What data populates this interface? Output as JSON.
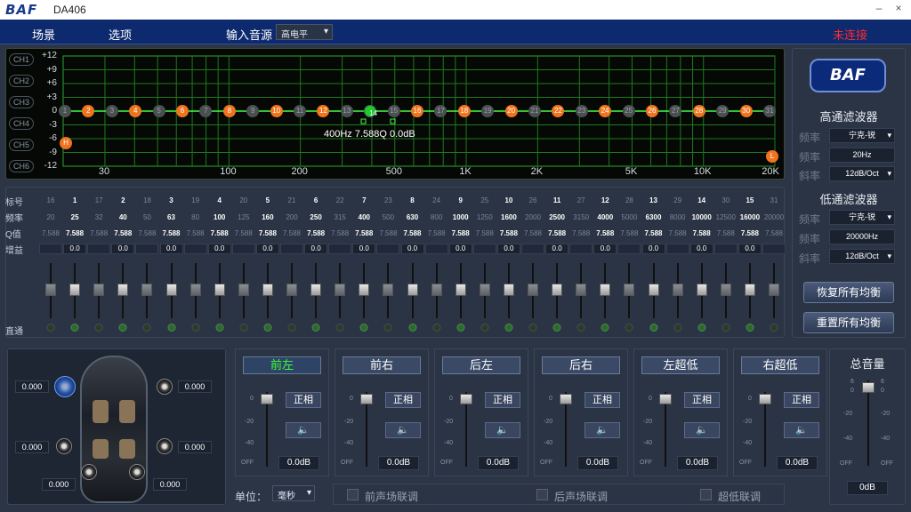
{
  "window": {
    "logo": "BAF",
    "title": "DA406",
    "minimize": "–",
    "close": "×"
  },
  "menu": {
    "scene": "场景",
    "options": "选项",
    "input_source_label": "输入音源",
    "input_source_value": "高电平",
    "connection_status": "未连接"
  },
  "graph": {
    "channels": [
      "CH1",
      "CH2",
      "CH3",
      "CH4",
      "CH5",
      "CH6"
    ],
    "y_ticks": [
      "+12",
      "+9",
      "+6",
      "+3",
      "0",
      "-3",
      "-6",
      "-9",
      "-12"
    ],
    "x_ticks": [
      "30",
      "100",
      "200",
      "500",
      "1K",
      "2K",
      "5K",
      "10K",
      "20K"
    ],
    "nodes": [
      "1",
      "2",
      "3",
      "4",
      "5",
      "6",
      "7",
      "8",
      "9",
      "10",
      "11",
      "12",
      "13",
      "14",
      "15",
      "16",
      "17",
      "18",
      "19",
      "20",
      "21",
      "22",
      "23",
      "24",
      "25",
      "26",
      "27",
      "28",
      "29",
      "30",
      "31"
    ],
    "active_nodes": [
      2,
      4,
      6,
      8,
      10,
      12,
      14,
      16,
      18,
      20,
      22,
      24,
      26,
      28,
      30
    ],
    "selected_node": 14,
    "highpass_marker": "H",
    "lowpass_marker": "L",
    "readout": "400Hz  7.588Q  0.0dB"
  },
  "eq": {
    "row_labels": {
      "index": "标号",
      "freq": "频率",
      "q": "Q值",
      "gain": "增益",
      "bypass": "直通"
    },
    "bands": [
      {
        "id": "16",
        "freq": "20",
        "q": "7.588",
        "main": false
      },
      {
        "id": "1",
        "freq": "25",
        "q": "7.588",
        "main": true
      },
      {
        "id": "17",
        "freq": "32",
        "q": "7.588",
        "main": false
      },
      {
        "id": "2",
        "freq": "40",
        "q": "7.588",
        "main": true
      },
      {
        "id": "18",
        "freq": "50",
        "q": "7.588",
        "main": false
      },
      {
        "id": "3",
        "freq": "63",
        "q": "7.588",
        "main": true
      },
      {
        "id": "19",
        "freq": "80",
        "q": "7.588",
        "main": false
      },
      {
        "id": "4",
        "freq": "100",
        "q": "7.588",
        "main": true
      },
      {
        "id": "20",
        "freq": "125",
        "q": "7.588",
        "main": false
      },
      {
        "id": "5",
        "freq": "160",
        "q": "7.588",
        "main": true
      },
      {
        "id": "21",
        "freq": "200",
        "q": "7.588",
        "main": false
      },
      {
        "id": "6",
        "freq": "250",
        "q": "7.588",
        "main": true
      },
      {
        "id": "22",
        "freq": "315",
        "q": "7.588",
        "main": false
      },
      {
        "id": "7",
        "freq": "400",
        "q": "7.588",
        "main": true
      },
      {
        "id": "23",
        "freq": "500",
        "q": "7.588",
        "main": false
      },
      {
        "id": "8",
        "freq": "630",
        "q": "7.588",
        "main": true
      },
      {
        "id": "24",
        "freq": "800",
        "q": "7.588",
        "main": false
      },
      {
        "id": "9",
        "freq": "1000",
        "q": "7.588",
        "main": true
      },
      {
        "id": "25",
        "freq": "1250",
        "q": "7.588",
        "main": false
      },
      {
        "id": "10",
        "freq": "1600",
        "q": "7.588",
        "main": true
      },
      {
        "id": "26",
        "freq": "2000",
        "q": "7.588",
        "main": false
      },
      {
        "id": "11",
        "freq": "2500",
        "q": "7.588",
        "main": true
      },
      {
        "id": "27",
        "freq": "3150",
        "q": "7.588",
        "main": false
      },
      {
        "id": "12",
        "freq": "4000",
        "q": "7.588",
        "main": true
      },
      {
        "id": "28",
        "freq": "5000",
        "q": "7.588",
        "main": false
      },
      {
        "id": "13",
        "freq": "6300",
        "q": "7.588",
        "main": true
      },
      {
        "id": "29",
        "freq": "8000",
        "q": "7.588",
        "main": false
      },
      {
        "id": "14",
        "freq": "10000",
        "q": "7.588",
        "main": true
      },
      {
        "id": "30",
        "freq": "12500",
        "q": "7.588",
        "main": false
      },
      {
        "id": "15",
        "freq": "16000",
        "q": "7.588",
        "main": true
      },
      {
        "id": "31",
        "freq": "20000",
        "q": "7.588",
        "main": false
      }
    ],
    "gain_value": "0.0"
  },
  "filters": {
    "logo": "BAF",
    "highpass_title": "高通滤波器",
    "lowpass_title": "低通滤波器",
    "type_label": "频率",
    "freq_label": "频率",
    "slope_label": "斜率",
    "hp_type": "宁克-锐",
    "hp_freq": "20Hz",
    "hp_slope": "12dB/Oct",
    "lp_type": "宁克-锐",
    "lp_freq": "20000Hz",
    "lp_slope": "12dB/Oct",
    "restore_all": "恢复所有均衡",
    "reset_all": "重置所有均衡"
  },
  "car": {
    "values": [
      "0.000",
      "0.000",
      "0.000",
      "0.000",
      "0.000",
      "0.000"
    ]
  },
  "outputs": {
    "scale": [
      "0",
      "-20",
      "-40",
      "OFF"
    ],
    "phase_label": "正相",
    "mute_icon": "speaker-icon",
    "channels": [
      {
        "name": "前左",
        "value": "0.0dB",
        "active": true
      },
      {
        "name": "前右",
        "value": "0.0dB",
        "active": false
      },
      {
        "name": "后左",
        "value": "0.0dB",
        "active": false
      },
      {
        "name": "后右",
        "value": "0.0dB",
        "active": false
      },
      {
        "name": "左超低",
        "value": "0.0dB",
        "active": false
      },
      {
        "name": "右超低",
        "value": "0.0dB",
        "active": false
      }
    ]
  },
  "units": {
    "label": "单位：",
    "value": "毫秒"
  },
  "links": {
    "front": "前声场联调",
    "rear": "后声场联调",
    "sub": "超低联调"
  },
  "master": {
    "title": "总音量",
    "scale": [
      "6",
      "0",
      "-20",
      "-40",
      "OFF"
    ],
    "value": "0dB"
  }
}
